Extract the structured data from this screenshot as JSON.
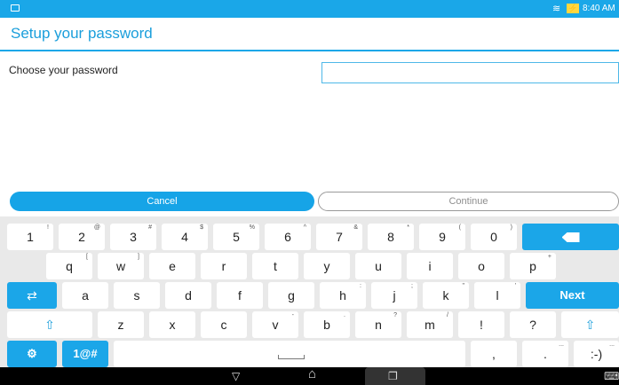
{
  "status_bar": {
    "time": "8:40 AM",
    "battery_icon": "battery-charging-icon",
    "wifi_icon": "wifi-icon",
    "notification_icon": "notification-icon"
  },
  "header": {
    "title": "Setup your password"
  },
  "form": {
    "label": "Choose your password",
    "value": "",
    "placeholder": ""
  },
  "actions": {
    "cancel": "Cancel",
    "continue": "Continue"
  },
  "keyboard": {
    "row1": [
      {
        "label": "1",
        "sup": "!"
      },
      {
        "label": "2",
        "sup": "@"
      },
      {
        "label": "3",
        "sup": "#"
      },
      {
        "label": "4",
        "sup": "$"
      },
      {
        "label": "5",
        "sup": "%"
      },
      {
        "label": "6",
        "sup": "^"
      },
      {
        "label": "7",
        "sup": "&"
      },
      {
        "label": "8",
        "sup": "*"
      },
      {
        "label": "9",
        "sup": "("
      },
      {
        "label": "0",
        "sup": ")"
      }
    ],
    "row2": [
      {
        "label": "q",
        "sup": "["
      },
      {
        "label": "w",
        "sup": "]"
      },
      {
        "label": "e",
        "sup": ""
      },
      {
        "label": "r",
        "sup": ""
      },
      {
        "label": "t",
        "sup": ""
      },
      {
        "label": "y",
        "sup": ""
      },
      {
        "label": "u",
        "sup": ""
      },
      {
        "label": "i",
        "sup": ""
      },
      {
        "label": "o",
        "sup": ""
      },
      {
        "label": "p",
        "sup": "+"
      }
    ],
    "row3": [
      {
        "label": "a",
        "sup": ""
      },
      {
        "label": "s",
        "sup": ""
      },
      {
        "label": "d",
        "sup": ""
      },
      {
        "label": "f",
        "sup": ""
      },
      {
        "label": "g",
        "sup": ""
      },
      {
        "label": "h",
        "sup": ":"
      },
      {
        "label": "j",
        "sup": ";"
      },
      {
        "label": "k",
        "sup": "\""
      },
      {
        "label": "l",
        "sup": "'"
      }
    ],
    "row4": [
      {
        "label": "z",
        "sup": ""
      },
      {
        "label": "x",
        "sup": ""
      },
      {
        "label": "c",
        "sup": ""
      },
      {
        "label": "v",
        "sup": "-"
      },
      {
        "label": "b",
        "sup": "."
      },
      {
        "label": "n",
        "sup": "?"
      },
      {
        "label": "m",
        "sup": "/"
      },
      {
        "label": "!",
        "sup": ""
      },
      {
        "label": "?",
        "sup": ""
      }
    ],
    "enter_label": "Next",
    "shift_symbol": "⇧",
    "tab_symbol": "⇄",
    "settings_symbol": "⚙",
    "symbols_label": "1@#",
    "comma": ",",
    "period": ".",
    "period_sup": "...",
    "smiley": ":-)",
    "smiley_sup": "..."
  },
  "nav_bar": {
    "back": "▽",
    "home": "⌂",
    "recent": "❐",
    "keyboard": "⌨"
  }
}
